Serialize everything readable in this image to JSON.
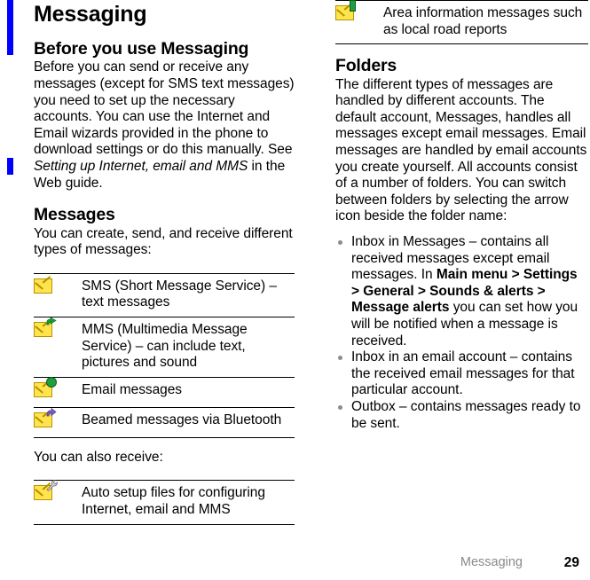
{
  "page": {
    "title": "Messaging",
    "footer_label": "Messaging",
    "footer_page": "29",
    "accent_change_bar_color": "#0000ff",
    "footer_label_color": "#8a8a8a"
  },
  "left_column": {
    "section_before": {
      "heading": "Before you use Messaging",
      "paragraph_part1": "Before you can send or receive any messages (except for SMS text messages) you need to set up the necessary accounts. You can use the Internet and Email wizards provided in the phone to download settings or do this manually. See ",
      "paragraph_italic": "Setting up Internet, email and MMS",
      "paragraph_part2": " in the Web guide."
    },
    "section_messages": {
      "heading": "Messages",
      "intro": "You can create, send, and receive different types of messages:",
      "also_receive": "You can also receive:",
      "types_table": [
        {
          "icon": "envelope-icon",
          "text": "SMS (Short Message Service) – text messages"
        },
        {
          "icon": "envelope-green-arrow-icon",
          "text": "MMS (Multimedia Message Service) – can include text, pictures and sound"
        },
        {
          "icon": "envelope-globe-icon",
          "text": "Email messages"
        },
        {
          "icon": "envelope-purple-arrow-icon",
          "text": "Beamed messages via Bluetooth"
        }
      ],
      "receive_table": [
        {
          "icon": "envelope-tool-icon",
          "text": "Auto setup files for configuring Internet, email and MMS"
        }
      ]
    }
  },
  "right_column": {
    "continued_table": [
      {
        "icon": "envelope-info-icon",
        "text": "Area information messages such as local road reports"
      }
    ],
    "section_folders": {
      "heading": "Folders",
      "paragraph": "The different types of messages are handled by different accounts. The default account, Messages, handles all messages except email messages. Email messages are handled by email accounts you create yourself. All accounts consist of a number of folders. You can switch between folders by selecting the arrow icon beside the folder name:",
      "bullets": [
        {
          "part1": "Inbox in Messages – contains all received messages except email messages. In ",
          "bold": "Main menu > Settings > General > Sounds & alerts > Message alerts",
          "part2": " you can set how you will be notified when a message is received."
        },
        {
          "part1": "Inbox in an email account – contains the received email messages for that particular account.",
          "bold": "",
          "part2": ""
        },
        {
          "part1": "Outbox – contains messages ready to be sent.",
          "bold": "",
          "part2": ""
        }
      ]
    }
  }
}
